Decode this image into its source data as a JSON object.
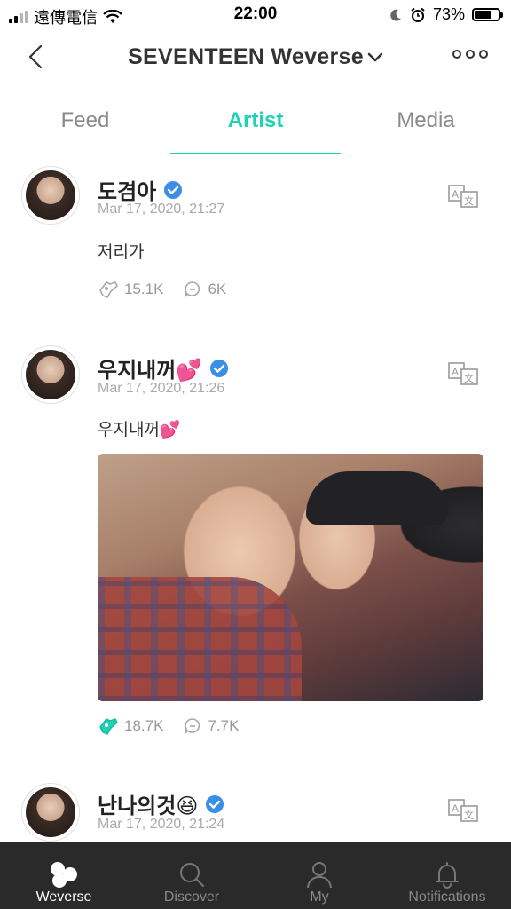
{
  "status_bar": {
    "carrier": "遠傳電信",
    "time": "22:00",
    "battery": "73%",
    "battery_level": 0.73
  },
  "header": {
    "title": "SEVENTEEN Weverse"
  },
  "tabs": [
    {
      "label": "Feed",
      "active": false
    },
    {
      "label": "Artist",
      "active": true
    },
    {
      "label": "Media",
      "active": false
    }
  ],
  "posts": [
    {
      "author": "도겸아",
      "date": "Mar 17, 2020, 21:27",
      "text": "저리가",
      "likes": "15.1K",
      "comments": "6K",
      "liked": false
    },
    {
      "author": "우지내꺼💕",
      "date": "Mar 17, 2020, 21:26",
      "text": "우지내꺼💕",
      "likes": "18.7K",
      "comments": "7.7K",
      "liked": true,
      "has_photo": true
    },
    {
      "author": "난나의것😆",
      "date": "Mar 17, 2020, 21:24"
    }
  ],
  "bottom_nav": [
    {
      "label": "Weverse",
      "active": true
    },
    {
      "label": "Discover",
      "active": false
    },
    {
      "label": "My",
      "active": false
    },
    {
      "label": "Notifications",
      "active": false
    }
  ],
  "colors": {
    "accent": "#1dd3b5",
    "verified": "#3b8ee6",
    "nav_bg": "#2a2a2a"
  }
}
